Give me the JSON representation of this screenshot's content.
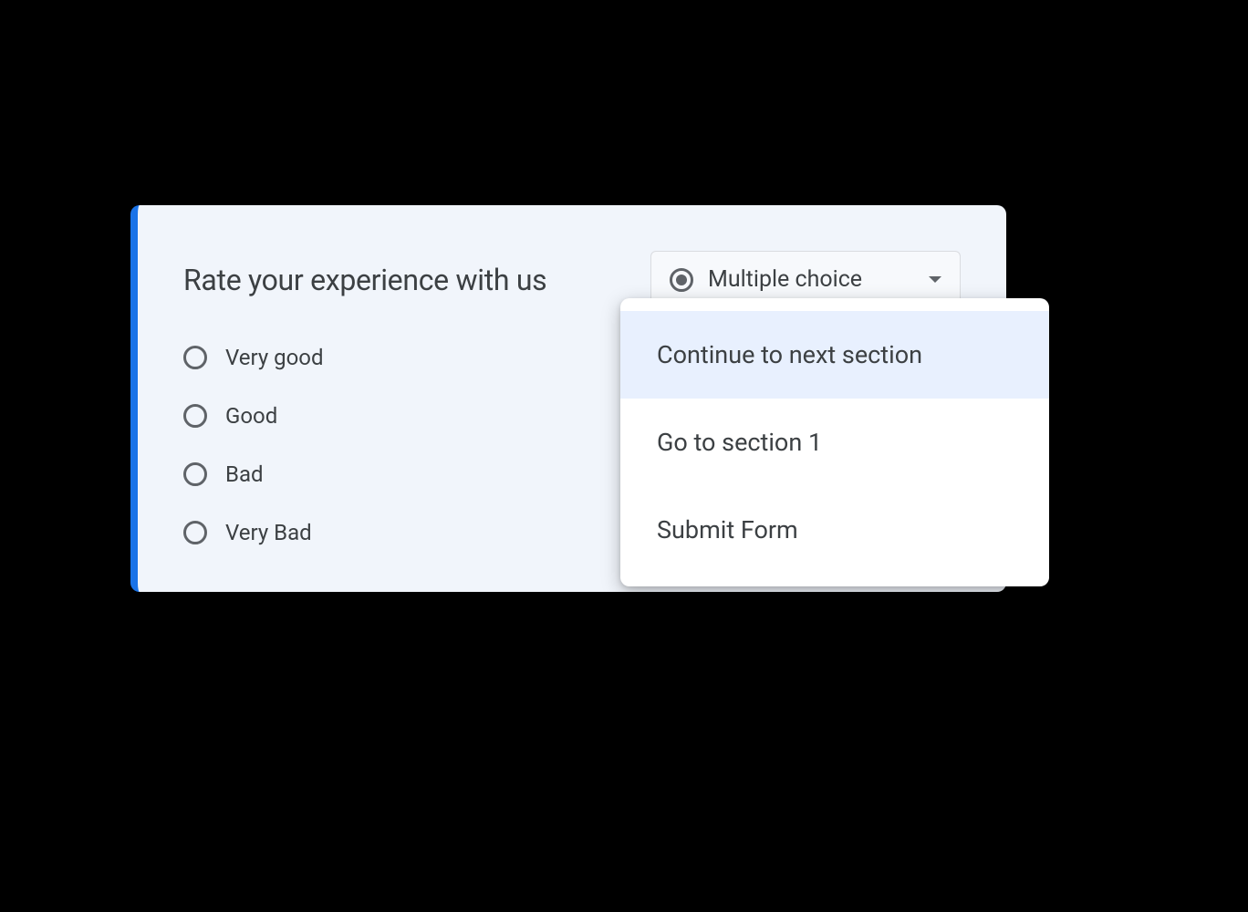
{
  "question": {
    "title": "Rate your experience with us",
    "type_label": "Multiple choice",
    "options": [
      "Very good",
      "Good",
      "Bad",
      "Very Bad"
    ]
  },
  "section_menu": {
    "items": [
      "Continue to next section",
      "Go to section 1",
      "Submit Form"
    ],
    "selected_index": 0
  }
}
